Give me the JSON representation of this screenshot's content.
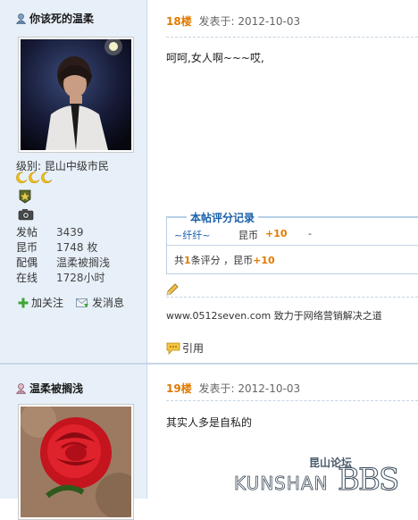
{
  "post1": {
    "author": "你该死的温柔",
    "level_label": "级别: 昆山中级市民",
    "stats": [
      {
        "key": "发帖",
        "value": "3439"
      },
      {
        "key": "昆币",
        "value": "1748 枚"
      },
      {
        "key": "配偶",
        "value": "温柔被搁浅"
      },
      {
        "key": "在线",
        "value": "1728小时"
      }
    ],
    "follow_label": "加关注",
    "message_label": "发消息",
    "floor": "18楼",
    "published": "发表于: 2012-10-03",
    "content": "呵呵,女人啊~~~哎,",
    "rating": {
      "title": "本帖评分记录",
      "entry_user": "~纤纤~",
      "entry_type": "昆币",
      "entry_value": "+10",
      "entry_note": "-",
      "summary_prefix": "共",
      "summary_count": "1",
      "summary_mid": "条评分 ，昆币",
      "summary_value": "+10"
    },
    "signature": "www.0512seven.com 致力于网络营销解决之道",
    "reply_label": "引用"
  },
  "post2": {
    "author": "温柔被搁浅",
    "floor": "19楼",
    "published": "发表于: 2012-10-03",
    "content": "其实人多是自私的"
  },
  "watermark": {
    "top_text": "昆山论坛",
    "brand": "KUNSHAN",
    "bbs": "BBS"
  }
}
